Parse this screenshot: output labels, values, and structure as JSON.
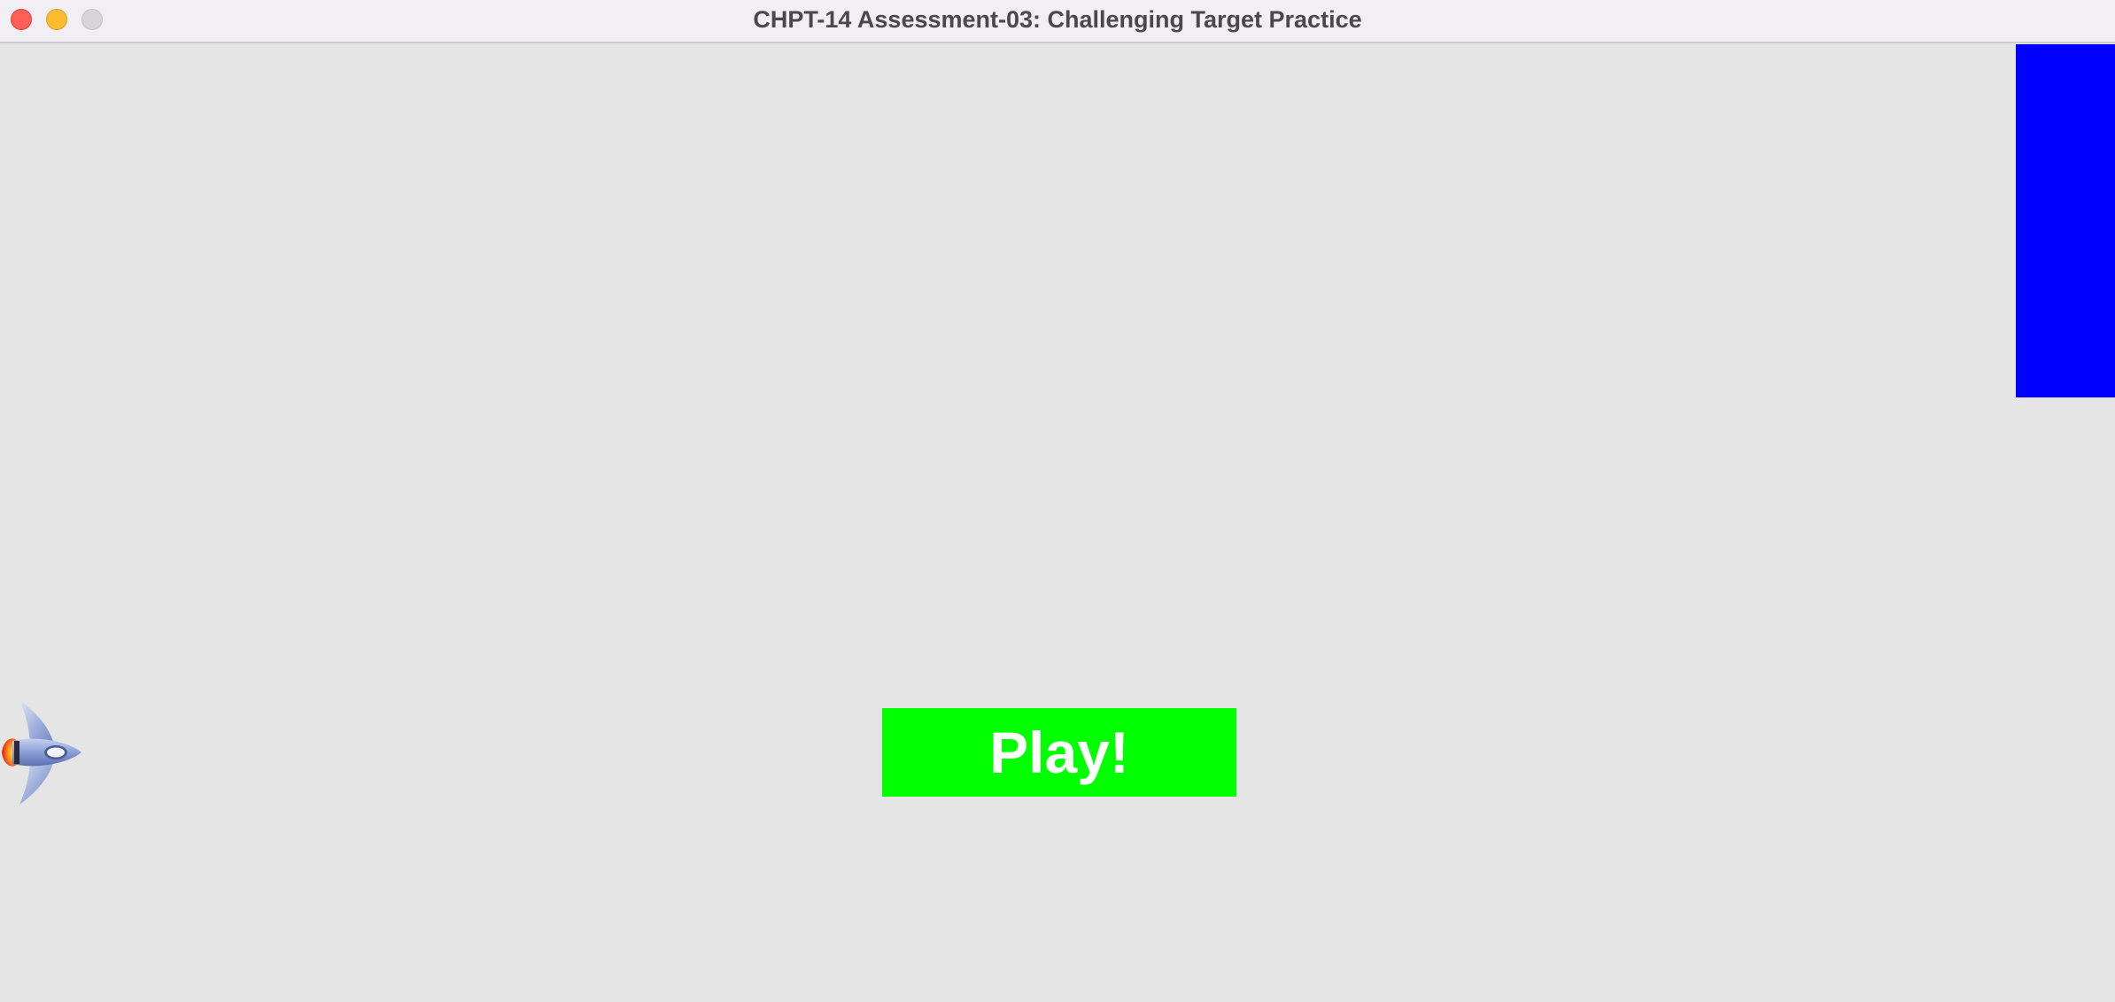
{
  "window": {
    "title": "CHPT-14 Assessment-03: Challenging Target Practice"
  },
  "game": {
    "play_label": "Play!",
    "colors": {
      "background": "#e5e5e5",
      "target": "#0000ff",
      "play_button": "#00ff00",
      "play_text": "#ffffff"
    },
    "sprites": {
      "player": "rocket-ship-icon",
      "target": "blue-target-block"
    }
  }
}
